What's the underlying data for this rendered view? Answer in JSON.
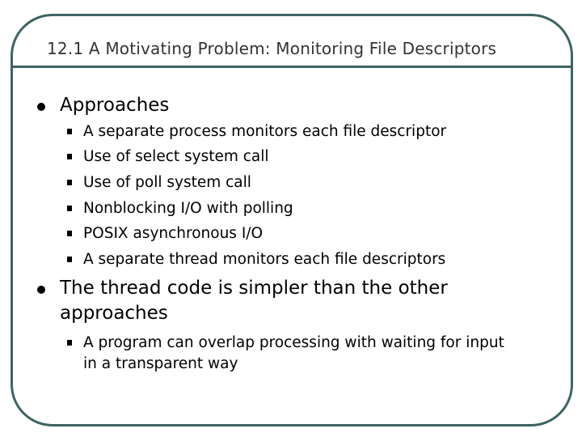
{
  "slide": {
    "title": "12.1 A Motivating Problem: Monitoring File Descriptors",
    "bullets": [
      {
        "text": "Approaches",
        "sub": [
          "A separate process monitors each file descriptor",
          "Use of select system call",
          "Use of poll system call",
          "Nonblocking I/O with polling",
          "POSIX asynchronous I/O",
          "A separate thread monitors each file descriptors"
        ]
      },
      {
        "text_line1": "The thread code is simpler than the other",
        "text_line2": "approaches",
        "sub_line1": "A program can overlap processing with waiting for input",
        "sub_line2": "in a transparent way"
      }
    ]
  },
  "colors": {
    "frame": "#3f6464"
  }
}
